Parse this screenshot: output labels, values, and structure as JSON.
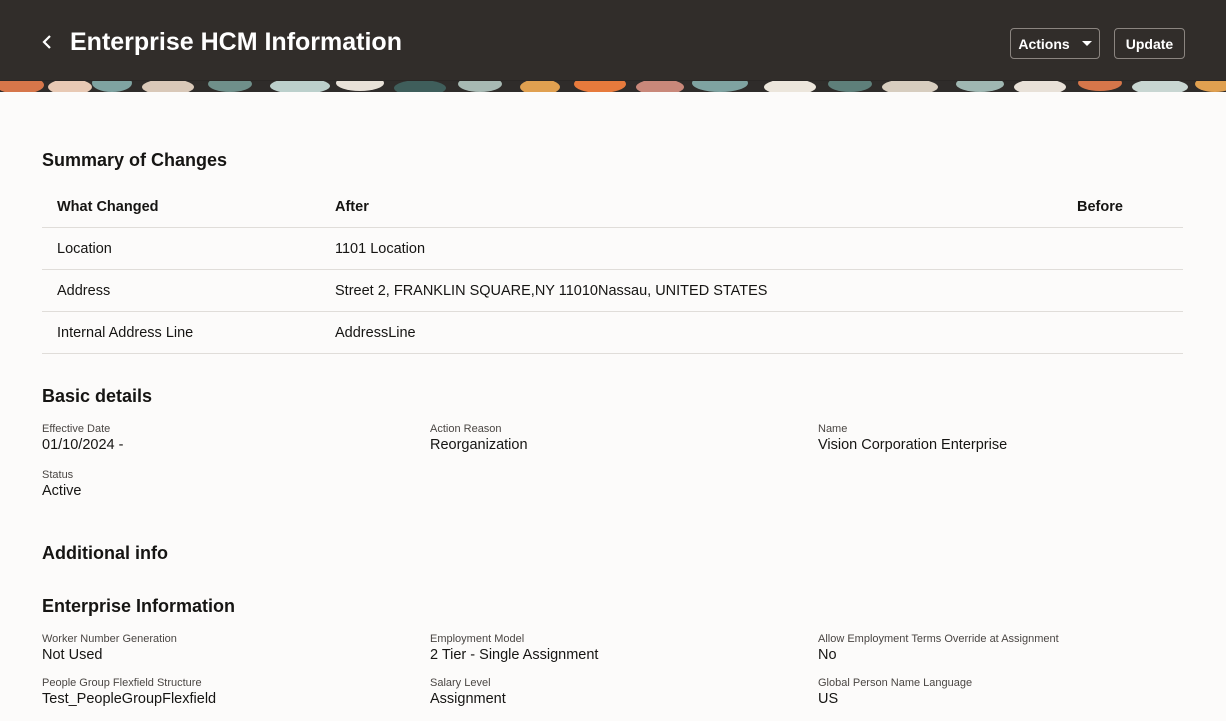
{
  "header": {
    "title": "Enterprise HCM Information",
    "actions_label": "Actions",
    "update_label": "Update"
  },
  "summary": {
    "title": "Summary of Changes",
    "columns": [
      "What Changed",
      "After",
      "Before"
    ],
    "rows": [
      {
        "what": "Location",
        "after": "1101 Location",
        "before": ""
      },
      {
        "what": "Address",
        "after": "Street 2, FRANKLIN SQUARE,NY 11010Nassau, UNITED STATES",
        "before": ""
      },
      {
        "what": "Internal Address Line",
        "after": "AddressLine",
        "before": ""
      }
    ]
  },
  "basic": {
    "title": "Basic details",
    "effective_date_label": "Effective Date",
    "effective_date": "01/10/2024 -",
    "action_reason_label": "Action Reason",
    "action_reason": "Reorganization",
    "name_label": "Name",
    "name": "Vision Corporation Enterprise",
    "status_label": "Status",
    "status": "Active"
  },
  "additional": {
    "title": "Additional info"
  },
  "enterprise": {
    "title": "Enterprise Information",
    "worker_number_label": "Worker Number Generation",
    "worker_number": "Not Used",
    "employment_model_label": "Employment Model",
    "employment_model": "2 Tier - Single Assignment",
    "allow_override_label": "Allow Employment Terms Override at Assignment",
    "allow_override": "No",
    "people_group_label": "People Group Flexfield Structure",
    "people_group": "Test_PeopleGroupFlexfield",
    "salary_level_label": "Salary Level",
    "salary_level": "Assignment",
    "name_language_label": "Global Person Name Language",
    "name_language": "US"
  }
}
